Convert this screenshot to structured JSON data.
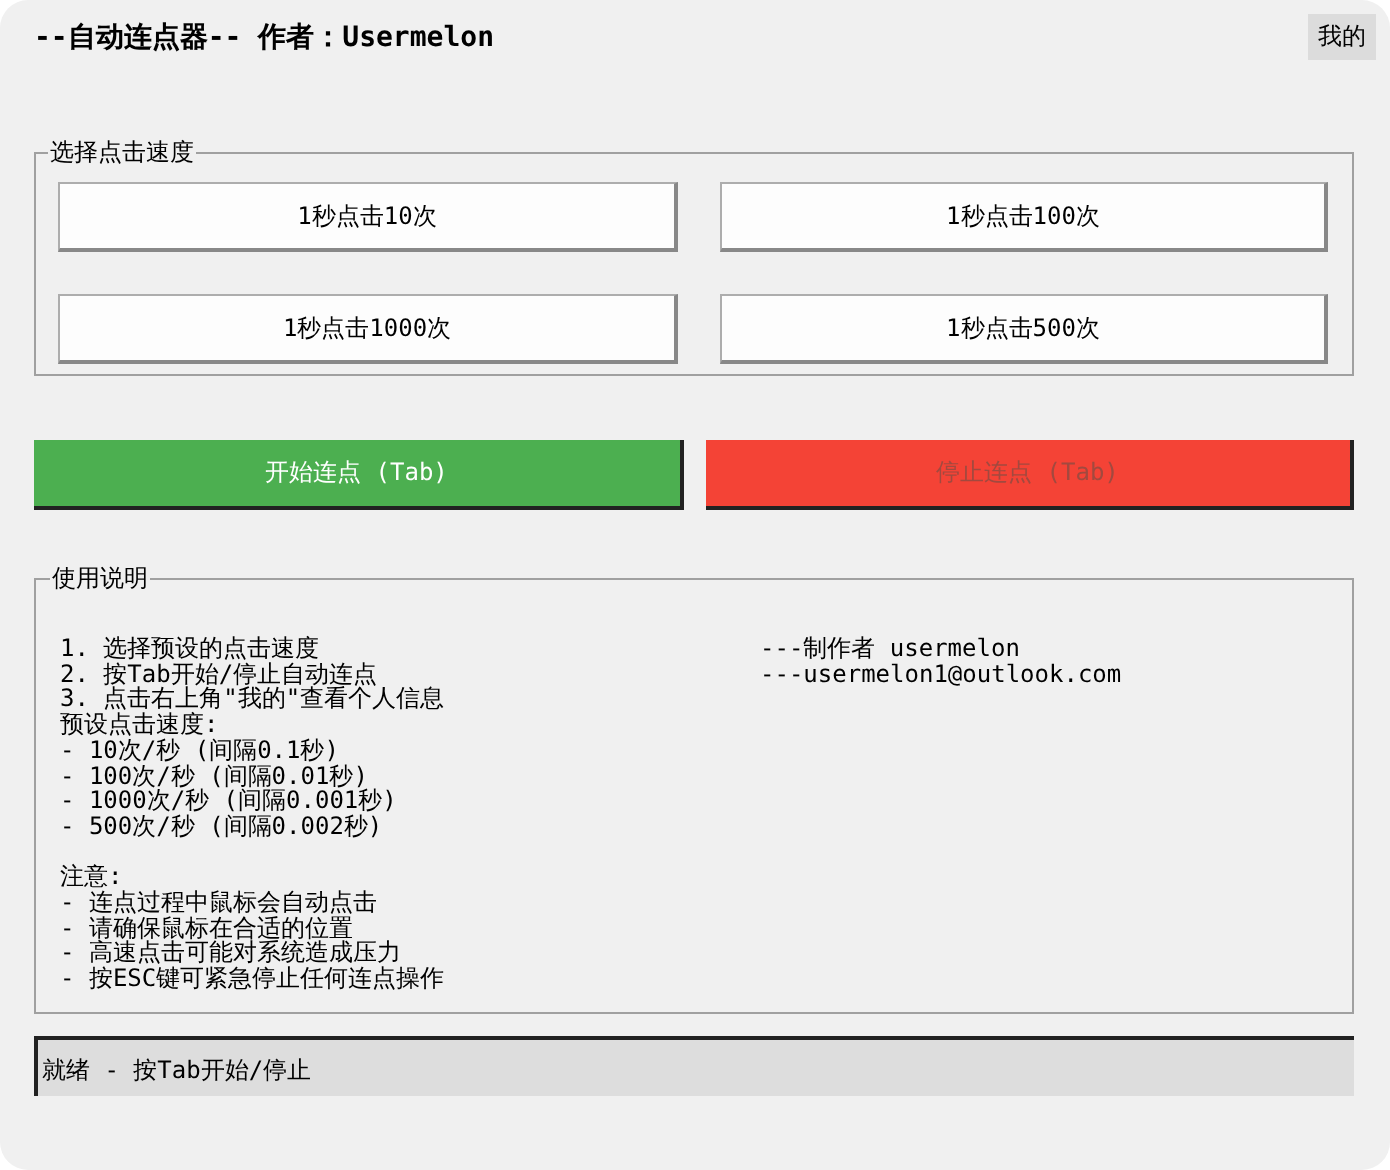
{
  "header": {
    "title": "--自动连点器-- 作者：Usermelon",
    "profile_button": "我的"
  },
  "speed_group": {
    "title": "选择点击速度",
    "buttons": [
      {
        "label": "1秒点击10次"
      },
      {
        "label": "1秒点击100次"
      },
      {
        "label": "1秒点击1000次"
      },
      {
        "label": "1秒点击500次"
      }
    ]
  },
  "actions": [
    {
      "label": "开始连点 (Tab)",
      "kind": "start",
      "disabled": false
    },
    {
      "label": "停止连点 (Tab)",
      "kind": "stop",
      "disabled": true
    }
  ],
  "instructions": {
    "title": "使用说明",
    "blocks": [
      [
        "1. 选择预设的点击速度",
        "2. 按Tab开始/停止自动连点",
        "3. 点击右上角\"我的\"查看个人信息",
        "预设点击速度:",
        "- 10次/秒 (间隔0.1秒)",
        "- 100次/秒 (间隔0.01秒)",
        "- 1000次/秒 (间隔0.001秒)",
        "- 500次/秒 (间隔0.002秒)"
      ],
      [
        "注意:",
        "- 连点过程中鼠标会自动点击",
        "- 请确保鼠标在合适的位置",
        "- 高速点击可能对系统造成压力",
        "- 按ESC键可紧急停止任何连点操作"
      ]
    ],
    "credits": [
      "---制作者 usermelon",
      "---usermelon1@outlook.com"
    ]
  },
  "status_bar": "就绪 - 按Tab开始/停止"
}
